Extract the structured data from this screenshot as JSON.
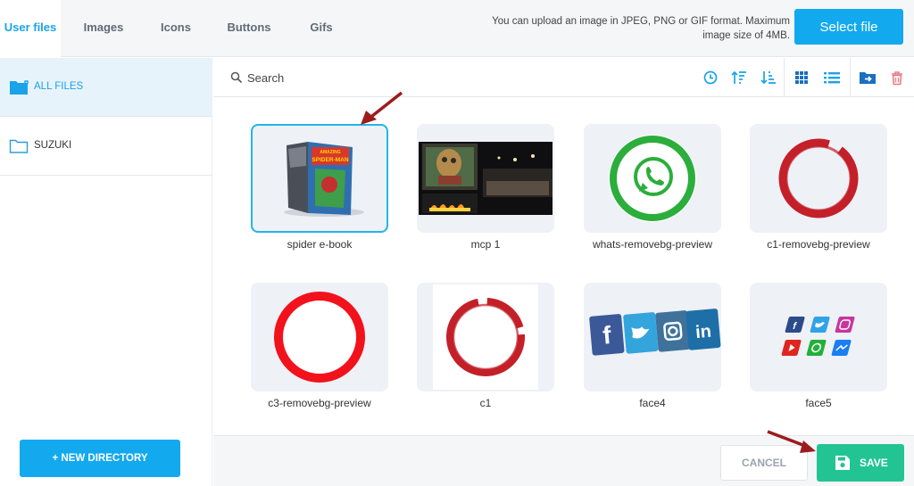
{
  "tabs": [
    {
      "label": "User files",
      "active": true
    },
    {
      "label": "Images"
    },
    {
      "label": "Icons"
    },
    {
      "label": "Buttons"
    },
    {
      "label": "Gifs"
    }
  ],
  "upload_note": "You can upload an image in JPEG, PNG or GIF format. Maximum image size of 4MB.",
  "select_file_label": "Select file",
  "sidebar": {
    "items": [
      {
        "label": "ALL FILES",
        "icon": "folder-filled-icon",
        "active": true
      },
      {
        "label": "SUZUKI",
        "icon": "folder-outline-icon"
      }
    ],
    "new_directory_label": "+ NEW DIRECTORY"
  },
  "search": {
    "placeholder": "Search",
    "value": ""
  },
  "toolbar_icons": [
    "clock-icon",
    "sort-ascending-icon",
    "sort-descending-icon",
    "grid-view-icon",
    "list-view-icon",
    "move-to-folder-icon",
    "trash-icon"
  ],
  "files": [
    {
      "name": "spider e-book",
      "selected": true
    },
    {
      "name": "mcp 1"
    },
    {
      "name": "whats-removebg-preview"
    },
    {
      "name": "c1-removebg-preview"
    },
    {
      "name": "c3-removebg-preview"
    },
    {
      "name": "c1"
    },
    {
      "name": "face4"
    },
    {
      "name": "face5"
    }
  ],
  "thumb_text": {
    "book_title_1": "AMAZING",
    "book_title_2": "SPIDER-MAN"
  },
  "footer": {
    "cancel_label": "CANCEL",
    "save_label": "SAVE"
  },
  "colors": {
    "accent": "#13a9ee",
    "save": "#22c493",
    "selection": "#22b6e8",
    "annotation_arrow": "#9b1c1c"
  }
}
